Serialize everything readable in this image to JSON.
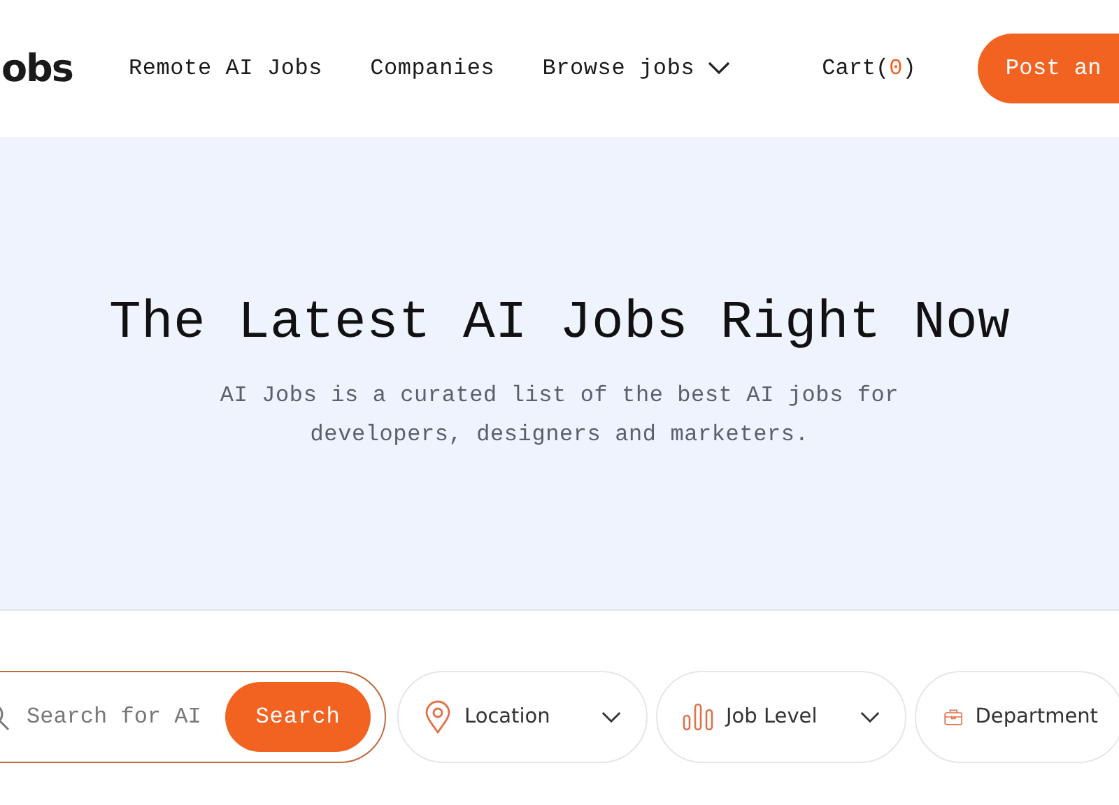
{
  "header": {
    "logo": "obs",
    "nav": [
      {
        "label": "Remote AI Jobs",
        "dropdown": false
      },
      {
        "label": "Companies",
        "dropdown": false
      },
      {
        "label": "Browse jobs",
        "dropdown": true
      }
    ],
    "cart": {
      "label": "Cart(",
      "count": "0",
      "suffix": ")"
    },
    "post_button": "Post an"
  },
  "hero": {
    "title": "The Latest AI Jobs Right Now",
    "subtitle": "AI Jobs is a curated list of the best AI jobs for developers, designers and marketers."
  },
  "search": {
    "placeholder": "Search for AI",
    "button": "Search"
  },
  "filters": [
    {
      "kind": "location",
      "label": "Location",
      "dropdown": true
    },
    {
      "kind": "level",
      "label": "Job Level",
      "dropdown": true
    },
    {
      "kind": "department",
      "label": "Department",
      "dropdown": false
    }
  ]
}
